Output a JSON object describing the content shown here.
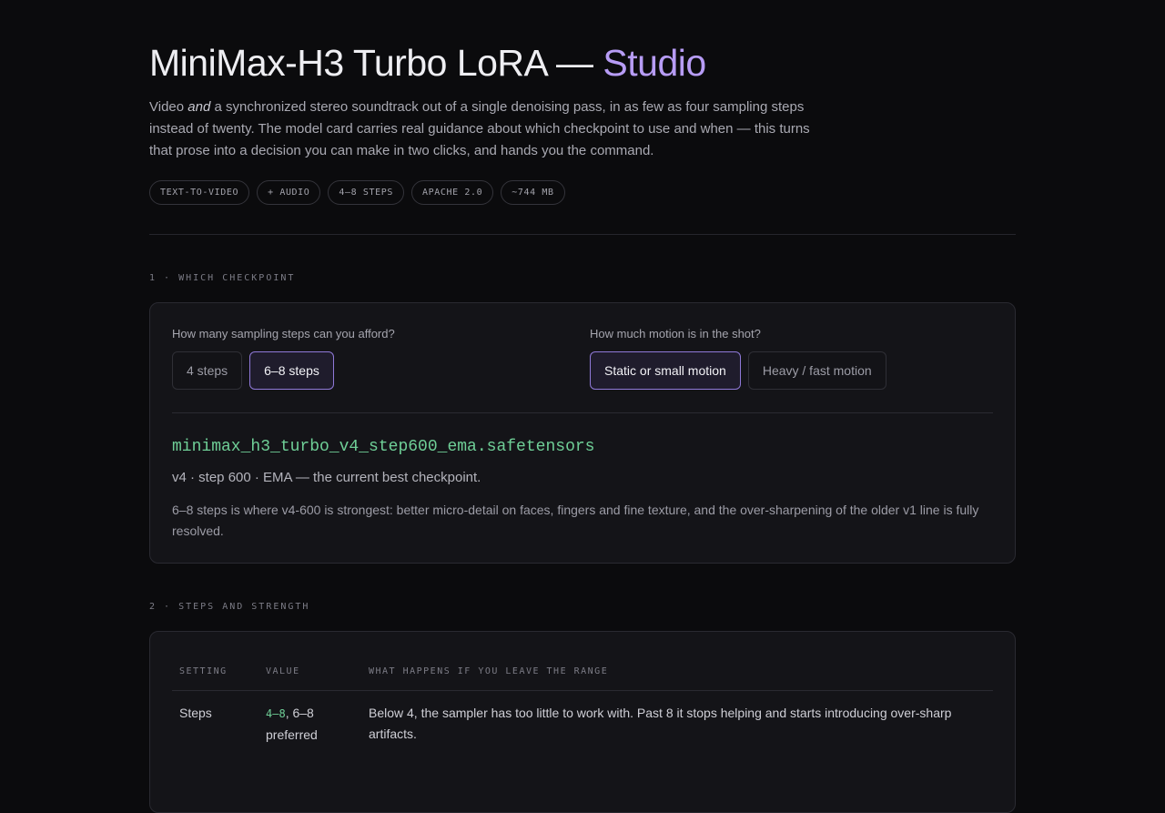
{
  "header": {
    "title_main": "MiniMax-H3 Turbo LoRA —",
    "title_accent": "Studio",
    "lede_pre": "Video ",
    "lede_em": "and",
    "lede_post": " a synchronized stereo soundtrack out of a single denoising pass, in as few as four sampling steps instead of twenty. The model card carries real guidance about which checkpoint to use and when — this turns that prose into a decision you can make in two clicks, and hands you the command.",
    "chips": [
      "TEXT-TO-VIDEO",
      "+ AUDIO",
      "4–8 STEPS",
      "APACHE 2.0",
      "~744 MB"
    ]
  },
  "section1": {
    "label": "1 · WHICH CHECKPOINT",
    "steps_question": "How many sampling steps can you afford?",
    "steps_options": [
      "4 steps",
      "6–8 steps"
    ],
    "steps_selected": "6–8 steps",
    "motion_question": "How much motion is in the shot?",
    "motion_options": [
      "Static or small motion",
      "Heavy / fast motion"
    ],
    "motion_selected": "Static or small motion",
    "result": {
      "filename": "minimax_h3_turbo_v4_step600_ema.safetensors",
      "summary": "v4 · step 600 · EMA — the current best checkpoint.",
      "description": "6–8 steps is where v4-600 is strongest: better micro-detail on faces, fingers and fine texture, and the over-sharpening of the older v1 line is fully resolved."
    }
  },
  "section2": {
    "label": "2 · STEPS AND STRENGTH",
    "columns": [
      "SETTING",
      "VALUE",
      "WHAT HAPPENS IF YOU LEAVE THE RANGE"
    ],
    "rows": [
      {
        "setting": "Steps",
        "value_range": "4–8",
        "value_rest": ", 6–8 preferred",
        "effect": "Below 4, the sampler has too little to work with. Past 8 it stops helping and starts introducing over-sharp artifacts."
      }
    ]
  }
}
